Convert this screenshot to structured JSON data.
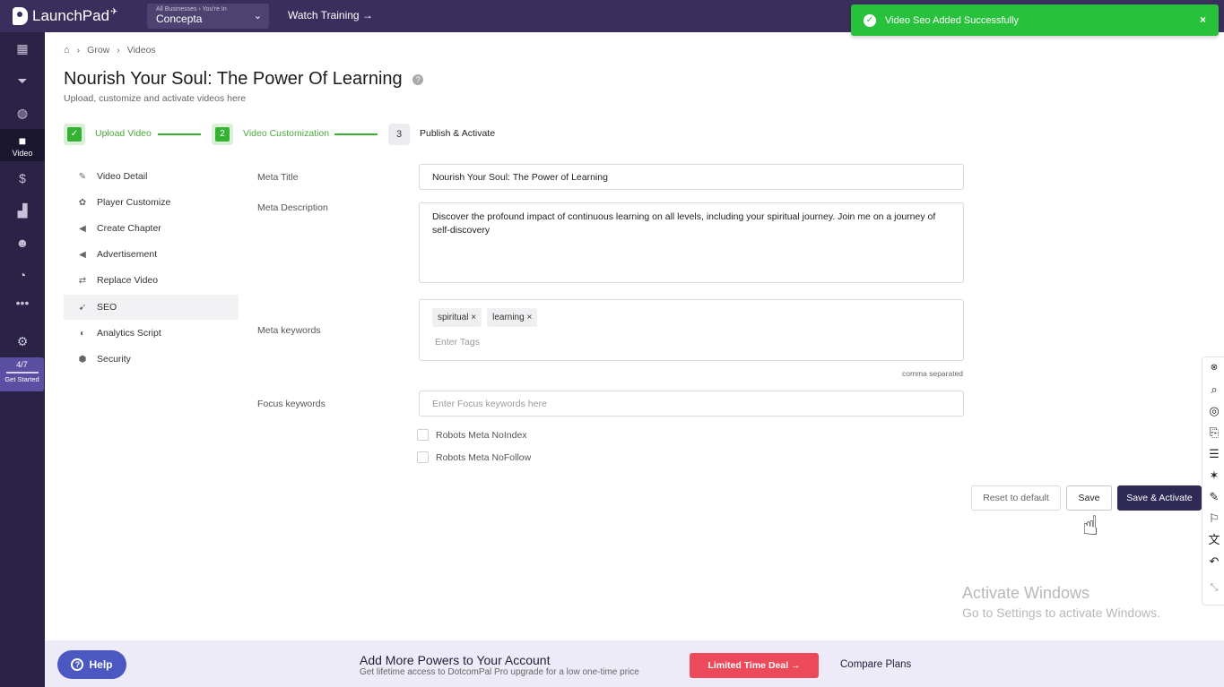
{
  "topbar": {
    "logo_text": "LaunchPad",
    "business_caption": "All Businesses › You're In",
    "business_name": "Concepta",
    "watch_training": "Watch Training →"
  },
  "toast": {
    "message": "Video Seo Added Successfully",
    "close": "×"
  },
  "rail": {
    "active_label": "Video",
    "progress": "4/7",
    "get_started": "Get Started"
  },
  "breadcrumb": [
    "Grow",
    "Videos"
  ],
  "page": {
    "title": "Nourish Your Soul: The Power Of Learning",
    "subtitle": "Upload, customize and activate videos here"
  },
  "steps": [
    {
      "label": "Upload Video",
      "marker": "✓"
    },
    {
      "label": "Video Customization",
      "marker": "2"
    },
    {
      "label": "Publish & Activate",
      "marker": "3"
    }
  ],
  "menu": [
    {
      "label": "Video Detail",
      "icon": "edit-icon"
    },
    {
      "label": "Player Customize",
      "icon": "palette-icon"
    },
    {
      "label": "Create Chapter",
      "icon": "megaphone-icon"
    },
    {
      "label": "Advertisement",
      "icon": "megaphone-icon"
    },
    {
      "label": "Replace Video",
      "icon": "swap-icon"
    },
    {
      "label": "SEO",
      "icon": "rocket-icon"
    },
    {
      "label": "Analytics Script",
      "icon": "chart-icon"
    },
    {
      "label": "Security",
      "icon": "shield-icon"
    }
  ],
  "form": {
    "meta_title_label": "Meta Title",
    "meta_title_value": "Nourish Your Soul: The Power of Learning",
    "meta_description_label": "Meta Description",
    "meta_description_value": "Discover the profound impact of continuous learning on all levels, including your spiritual journey. Join me on a journey of self-discovery",
    "meta_keywords_label": "Meta keywords",
    "tags": [
      "spiritual",
      "learning"
    ],
    "tag_remove": "×",
    "tags_placeholder": "Enter Tags",
    "tags_hint": "comma separated",
    "focus_keywords_label": "Focus keywords",
    "focus_keywords_placeholder": "Enter Focus keywords here",
    "noindex_label": "Robots Meta NoIndex",
    "nofollow_label": "Robots Meta NoFollow"
  },
  "buttons": {
    "reset": "Reset to default",
    "save": "Save",
    "save_activate": "Save & Activate"
  },
  "watermark": {
    "line1": "Activate Windows",
    "line2": "Go to Settings to activate Windows."
  },
  "promo": {
    "help": "Help",
    "title": "Add More Powers to Your Account",
    "subtitle": "Get lifetime access to DotcomPal Pro upgrade for a low one-time price",
    "deal": "Limited Time Deal →",
    "compare": "Compare Plans"
  }
}
